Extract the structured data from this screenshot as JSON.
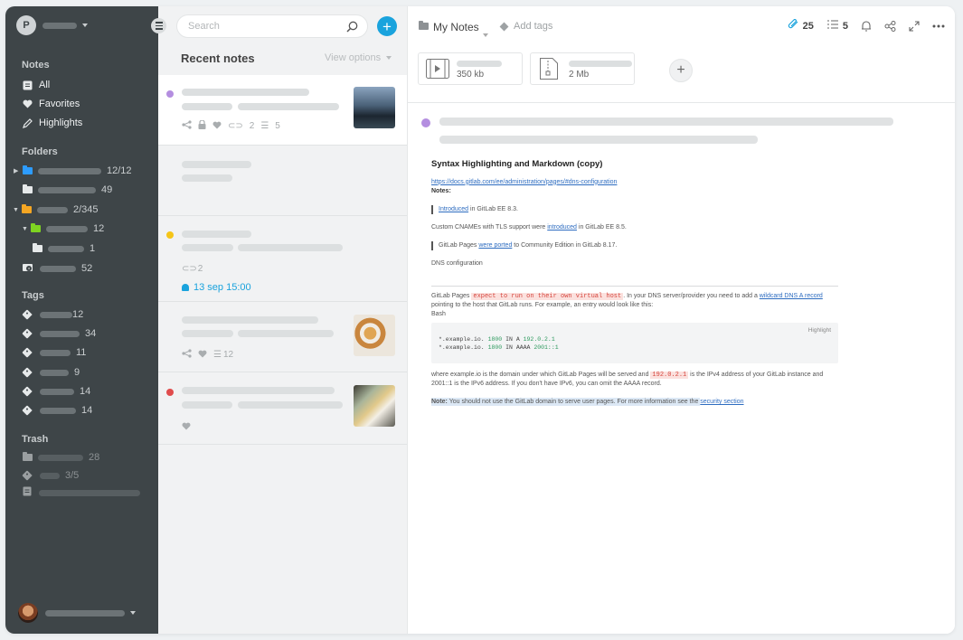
{
  "sidebar": {
    "account_initial": "P",
    "sections": {
      "notes": "Notes",
      "folders": "Folders",
      "tags": "Tags",
      "trash": "Trash"
    },
    "notes_items": [
      {
        "label": "All",
        "icon": "note-icon"
      },
      {
        "label": "Favorites",
        "icon": "heart-icon"
      },
      {
        "label": "Highlights",
        "icon": "pen-icon"
      }
    ],
    "folders": [
      {
        "count": "12/12",
        "color": "#2d9cff"
      },
      {
        "count": "49",
        "color": "#e6e9ea"
      },
      {
        "count": "2/345",
        "color": "#f5a623"
      },
      {
        "count": "12",
        "color": "#7ed321"
      },
      {
        "count": "1",
        "color": "#e6e9ea"
      },
      {
        "count": "52",
        "color": "#e6e9ea"
      }
    ],
    "tags": [
      "12",
      "34",
      "11",
      "9",
      "14",
      "14"
    ],
    "trash": [
      "28",
      "3/5",
      ""
    ]
  },
  "list": {
    "search_placeholder": "Search",
    "title": "Recent notes",
    "view_options": "View options",
    "notes": [
      {
        "dot": "#b48ee0",
        "links": "2",
        "tasks": "5"
      },
      {
        "dot": "",
        "links": "",
        "tasks": ""
      },
      {
        "dot": "#f5c518",
        "links": "2",
        "reminder": "13 sep 15:00"
      },
      {
        "dot": "",
        "tasks": "12"
      },
      {
        "dot": "#e04c4c"
      }
    ]
  },
  "editor": {
    "notebook": "My Notes",
    "add_tags": "Add tags",
    "attachments_count": "25",
    "tasks_count": "5",
    "attachments": [
      {
        "size": "350 kb",
        "icon": "video-file-icon"
      },
      {
        "size": "2 Mb",
        "icon": "archive-file-icon"
      }
    ],
    "doc": {
      "title": "Syntax Highlighting and Markdown (copy)",
      "link": "https://docs.gitlab.com/ee/administration/pages/#dns-configuration",
      "notes_label": "Notes:",
      "q1_link": "Introduced",
      "q1_rest": " in GitLab EE 8.3.",
      "p1_a": "Custom CNAMEs with TLS support were ",
      "p1_link": "introduced",
      "p1_b": " in GitLab EE 8.5.",
      "q2_a": "GitLab Pages ",
      "q2_link": "were ported",
      "q2_b": " to Community Edition in GitLab 8.17.",
      "dns": "DNS configuration",
      "p2_a": "GitLab Pages ",
      "p2_code": "expect to run on their own virtual host",
      "p2_b": ". In your DNS server/provider you need to add a ",
      "p2_link": "wildcard DNS A record",
      "p2_c": " pointing to the host that GitLab runs. For example, an entry would look like this:",
      "bash": "Bash",
      "code_label": "Highlight",
      "code_line1_a": "*.example.io. ",
      "code_line1_num": "1800",
      "code_line1_b": " IN A ",
      "code_line1_ip": "192.0.2.1",
      "code_line2_a": "*.example.io. ",
      "code_line2_num": "1800",
      "code_line2_b": " IN AAAA ",
      "code_line2_ip": "2001::1",
      "p3_a": "where example.io is the domain under which GitLab Pages will be served and ",
      "p3_code": "192.0.2.1",
      "p3_b": " is the IPv4 address of your GitLab instance and 2001::1 is the IPv6 address. If you don't have IPv6, you can omit the AAAA record.",
      "note_bold": "Note:",
      "note_text": " You should not use the GitLab domain to serve user pages. For more information see the ",
      "note_link": "security section"
    }
  }
}
